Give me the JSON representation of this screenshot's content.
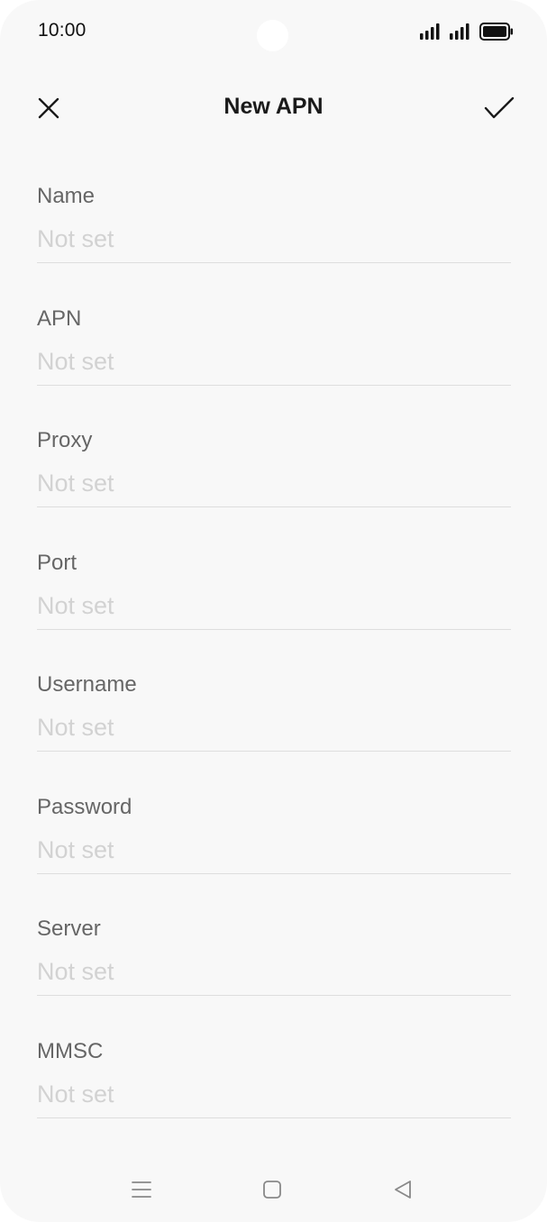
{
  "status_bar": {
    "time": "10:00"
  },
  "header": {
    "title": "New APN",
    "close_icon": "close-icon",
    "confirm_icon": "check-icon"
  },
  "fields": [
    {
      "label": "Name",
      "value": "Not set"
    },
    {
      "label": "APN",
      "value": "Not set"
    },
    {
      "label": "Proxy",
      "value": "Not set"
    },
    {
      "label": "Port",
      "value": "Not set"
    },
    {
      "label": "Username",
      "value": "Not set"
    },
    {
      "label": "Password",
      "value": "Not set"
    },
    {
      "label": "Server",
      "value": "Not set"
    },
    {
      "label": "MMSC",
      "value": "Not set"
    }
  ],
  "nav_bar": {
    "menu_icon": "menu-icon",
    "home_icon": "home-icon",
    "back_icon": "back-icon"
  },
  "colors": {
    "background": "#f8f8f8",
    "label": "#666666",
    "placeholder": "#d2d2d2",
    "divider": "#dedede",
    "title": "#1a1a1a"
  }
}
